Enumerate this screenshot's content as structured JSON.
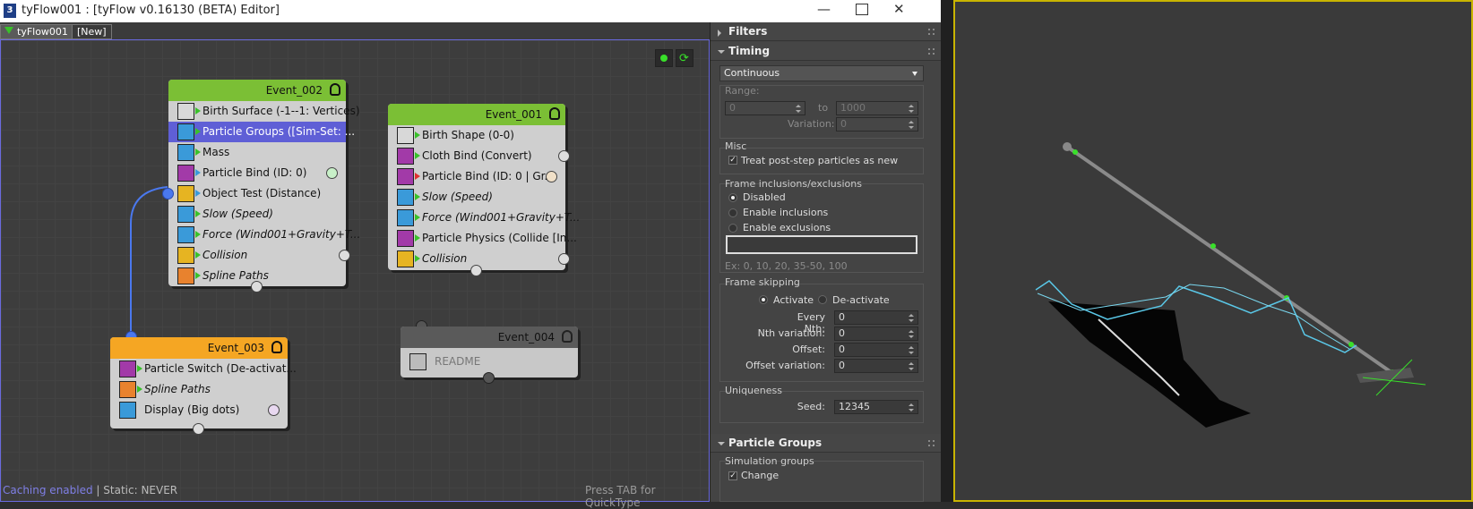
{
  "window": {
    "title": "tyFlow001 : [tyFlow v0.16130 (BETA) Editor]",
    "app_icon": "3"
  },
  "tabs": [
    {
      "label": "tyFlow001"
    },
    {
      "label": "[New]"
    }
  ],
  "nodes": {
    "event_002": {
      "title": "Event_002",
      "header_color": "#7bbf35",
      "ops": [
        "Birth Surface (-1--1: Vertices)",
        "Particle Groups ([Sim-Set: ...",
        "Mass",
        "Particle Bind (ID: 0)",
        "Object Test (Distance)",
        "Slow (Speed)",
        "Force (Wind001+Gravity+T...",
        "Collision",
        "Spline Paths"
      ]
    },
    "event_001": {
      "title": "Event_001",
      "header_color": "#7bbf35",
      "ops": [
        "Birth Shape (0-0)",
        "Cloth Bind (Convert)",
        "Particle Bind (ID: 0 | Gr...",
        "Slow (Speed)",
        "Force (Wind001+Gravity+T...",
        "Particle Physics (Collide [In...",
        "Collision"
      ]
    },
    "event_003": {
      "title": "Event_003",
      "header_color": "#f5a623",
      "ops": [
        "Particle Switch (De-activat...",
        "Spline Paths",
        "Display (Big dots)"
      ]
    },
    "event_004": {
      "title": "Event_004",
      "header_color": "#5a5a5a",
      "ops": [
        "README"
      ]
    }
  },
  "footer": {
    "caching": "Caching enabled",
    "static": " | Static: NEVER",
    "hint": "Press TAB for QuickType"
  },
  "panel": {
    "filters": "Filters",
    "timing": "Timing",
    "timing_mode": "Continuous",
    "range_label": "Range:",
    "range_from": "0",
    "range_to_label": "to",
    "range_to": "1000",
    "variation_label": "Variation:",
    "variation": "0",
    "misc_label": "Misc",
    "treat_post_step": "Treat post-step particles as new",
    "frame_incl_label": "Frame inclusions/exclusions",
    "disabled": "Disabled",
    "enable_inclusions": "Enable inclusions",
    "enable_exclusions": "Enable exclusions",
    "frames_example": "Ex: 0, 10, 20, 35-50, 100",
    "frame_skipping_label": "Frame skipping",
    "activate": "Activate",
    "deactivate": "De-activate",
    "every_nth_label": "Every Nth:",
    "every_nth": "0",
    "nth_variation_label": "Nth variation:",
    "nth_variation": "0",
    "offset_label": "Offset:",
    "offset": "0",
    "offset_variation_label": "Offset variation:",
    "offset_variation": "0",
    "uniqueness_label": "Uniqueness",
    "seed_label": "Seed:",
    "seed": "12345",
    "particle_groups": "Particle Groups",
    "simulation_groups": "Simulation groups",
    "change_label": "Change"
  }
}
